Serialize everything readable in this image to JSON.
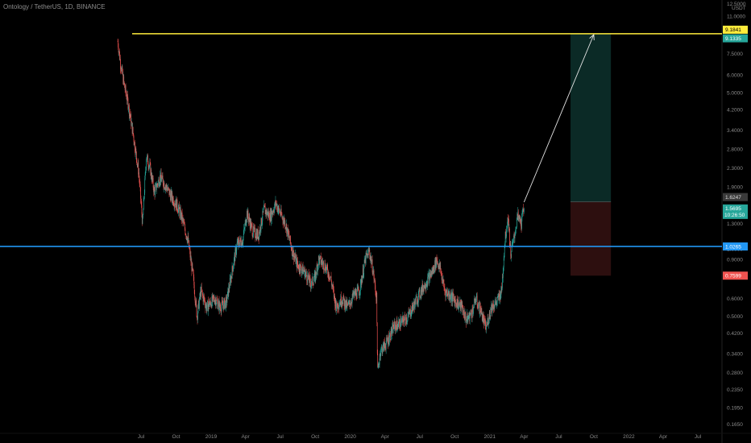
{
  "header": {
    "title": "Ontology / TetherUS, 1D, BINANCE"
  },
  "currency_label": "USDT",
  "colors": {
    "up": "#26a69a",
    "down": "#ef5350",
    "resistance_line": "#ffeb3b",
    "support_line": "#2196f3",
    "target_zone": "#0b2a26",
    "stop_zone": "#2d0f0f",
    "arrow": "#e6e6e6",
    "current_price_tag": "#26a69a",
    "stop_tag": "#ef5350",
    "target_tag": "#ffeb3b",
    "support_tag": "#2196f3",
    "entry_tag": "#3a3a3a"
  },
  "chart_data": {
    "type": "candlestick",
    "scale": "log",
    "ylim": [
      0.16,
      13.0
    ],
    "y_ticks": [
      "12.5000",
      "11.0000",
      "9.0000",
      "7.5000",
      "6.0000",
      "5.0000",
      "4.2000",
      "3.4000",
      "2.8000",
      "2.3000",
      "1.9000",
      "1.5000",
      "1.3000",
      "1.0000",
      "0.9000",
      "0.7500",
      "0.6000",
      "0.5000",
      "0.4200",
      "0.3400",
      "0.2800",
      "0.2350",
      "0.1950",
      "0.1650"
    ],
    "x_ticks": [
      {
        "label": "Jul",
        "date": "2018-07-01"
      },
      {
        "label": "Oct",
        "date": "2018-10-01"
      },
      {
        "label": "2019",
        "date": "2019-01-01"
      },
      {
        "label": "Apr",
        "date": "2019-04-01"
      },
      {
        "label": "Jul",
        "date": "2019-07-01"
      },
      {
        "label": "Oct",
        "date": "2019-10-01"
      },
      {
        "label": "2020",
        "date": "2020-01-01"
      },
      {
        "label": "Apr",
        "date": "2020-04-01"
      },
      {
        "label": "Jul",
        "date": "2020-07-01"
      },
      {
        "label": "Oct",
        "date": "2020-10-01"
      },
      {
        "label": "2021",
        "date": "2021-01-01"
      },
      {
        "label": "Apr",
        "date": "2021-04-01"
      },
      {
        "label": "Jul",
        "date": "2021-07-01"
      },
      {
        "label": "Oct",
        "date": "2021-10-01"
      },
      {
        "label": "2022",
        "date": "2022-01-01"
      },
      {
        "label": "Apr",
        "date": "2022-04-01"
      },
      {
        "label": "Jul",
        "date": "2022-07-01"
      }
    ],
    "price_path": [
      {
        "date": "2018-05-01",
        "price": 8.5
      },
      {
        "date": "2018-05-08",
        "price": 6.8
      },
      {
        "date": "2018-05-18",
        "price": 5.4
      },
      {
        "date": "2018-05-28",
        "price": 4.5
      },
      {
        "date": "2018-06-10",
        "price": 3.3
      },
      {
        "date": "2018-06-25",
        "price": 2.2
      },
      {
        "date": "2018-07-05",
        "price": 1.3
      },
      {
        "date": "2018-07-15",
        "price": 2.6
      },
      {
        "date": "2018-07-25",
        "price": 2.3
      },
      {
        "date": "2018-08-05",
        "price": 1.8
      },
      {
        "date": "2018-08-20",
        "price": 2.1
      },
      {
        "date": "2018-09-05",
        "price": 1.9
      },
      {
        "date": "2018-09-20",
        "price": 1.7
      },
      {
        "date": "2018-10-01",
        "price": 1.6
      },
      {
        "date": "2018-10-15",
        "price": 1.4
      },
      {
        "date": "2018-11-01",
        "price": 1.1
      },
      {
        "date": "2018-11-15",
        "price": 0.75
      },
      {
        "date": "2018-11-25",
        "price": 0.5
      },
      {
        "date": "2018-12-05",
        "price": 0.65
      },
      {
        "date": "2018-12-20",
        "price": 0.55
      },
      {
        "date": "2019-01-10",
        "price": 0.6
      },
      {
        "date": "2019-01-25",
        "price": 0.55
      },
      {
        "date": "2019-02-10",
        "price": 0.58
      },
      {
        "date": "2019-02-25",
        "price": 0.8
      },
      {
        "date": "2019-03-10",
        "price": 1.05
      },
      {
        "date": "2019-03-25",
        "price": 1.1
      },
      {
        "date": "2019-04-05",
        "price": 1.45
      },
      {
        "date": "2019-04-20",
        "price": 1.2
      },
      {
        "date": "2019-05-05",
        "price": 1.15
      },
      {
        "date": "2019-05-20",
        "price": 1.5
      },
      {
        "date": "2019-06-05",
        "price": 1.4
      },
      {
        "date": "2019-06-20",
        "price": 1.6
      },
      {
        "date": "2019-07-01",
        "price": 1.45
      },
      {
        "date": "2019-07-15",
        "price": 1.3
      },
      {
        "date": "2019-08-01",
        "price": 1.0
      },
      {
        "date": "2019-08-15",
        "price": 0.85
      },
      {
        "date": "2019-09-01",
        "price": 0.8
      },
      {
        "date": "2019-09-20",
        "price": 0.7
      },
      {
        "date": "2019-10-01",
        "price": 0.75
      },
      {
        "date": "2019-10-10",
        "price": 0.9
      },
      {
        "date": "2019-10-25",
        "price": 0.85
      },
      {
        "date": "2019-11-10",
        "price": 0.75
      },
      {
        "date": "2019-11-25",
        "price": 0.55
      },
      {
        "date": "2019-12-10",
        "price": 0.6
      },
      {
        "date": "2019-12-25",
        "price": 0.55
      },
      {
        "date": "2020-01-10",
        "price": 0.62
      },
      {
        "date": "2020-01-25",
        "price": 0.65
      },
      {
        "date": "2020-02-10",
        "price": 0.9
      },
      {
        "date": "2020-02-20",
        "price": 0.98
      },
      {
        "date": "2020-03-01",
        "price": 0.8
      },
      {
        "date": "2020-03-10",
        "price": 0.6
      },
      {
        "date": "2020-03-13",
        "price": 0.28
      },
      {
        "date": "2020-03-20",
        "price": 0.35
      },
      {
        "date": "2020-04-05",
        "price": 0.38
      },
      {
        "date": "2020-04-25",
        "price": 0.45
      },
      {
        "date": "2020-05-15",
        "price": 0.47
      },
      {
        "date": "2020-06-01",
        "price": 0.5
      },
      {
        "date": "2020-06-20",
        "price": 0.58
      },
      {
        "date": "2020-07-05",
        "price": 0.65
      },
      {
        "date": "2020-07-20",
        "price": 0.72
      },
      {
        "date": "2020-08-05",
        "price": 0.8
      },
      {
        "date": "2020-08-15",
        "price": 0.9
      },
      {
        "date": "2020-08-25",
        "price": 0.8
      },
      {
        "date": "2020-09-05",
        "price": 0.65
      },
      {
        "date": "2020-09-20",
        "price": 0.62
      },
      {
        "date": "2020-10-05",
        "price": 0.58
      },
      {
        "date": "2020-10-20",
        "price": 0.55
      },
      {
        "date": "2020-11-01",
        "price": 0.48
      },
      {
        "date": "2020-11-15",
        "price": 0.52
      },
      {
        "date": "2020-11-25",
        "price": 0.6
      },
      {
        "date": "2020-12-10",
        "price": 0.52
      },
      {
        "date": "2020-12-22",
        "price": 0.44
      },
      {
        "date": "2021-01-05",
        "price": 0.55
      },
      {
        "date": "2021-01-20",
        "price": 0.58
      },
      {
        "date": "2021-02-01",
        "price": 0.65
      },
      {
        "date": "2021-02-10",
        "price": 1.1
      },
      {
        "date": "2021-02-18",
        "price": 1.4
      },
      {
        "date": "2021-02-25",
        "price": 0.95
      },
      {
        "date": "2021-03-05",
        "price": 1.1
      },
      {
        "date": "2021-03-15",
        "price": 1.4
      },
      {
        "date": "2021-03-25",
        "price": 1.3
      },
      {
        "date": "2021-04-01",
        "price": 1.5695
      }
    ],
    "annotations": {
      "resistance_level": 9.1841,
      "support_level": 1.0265,
      "entry_price": 1.6247,
      "target_price": 9.1335,
      "stop_price": 0.7599,
      "current_price": 1.5695,
      "countdown": "10:26:50",
      "position_start": "2021-08-01",
      "position_end": "2021-11-15",
      "arrow_from": {
        "date": "2021-04-01",
        "price": 1.62
      },
      "arrow_to": {
        "date": "2021-10-01",
        "price": 9.1
      }
    }
  },
  "price_labels": {
    "resistance": "9.1841",
    "target": "9.1335",
    "entry": "1.6247",
    "current": "1.5695",
    "countdown": "10:26:50",
    "support": "1.0265",
    "stop": "0.7599"
  }
}
